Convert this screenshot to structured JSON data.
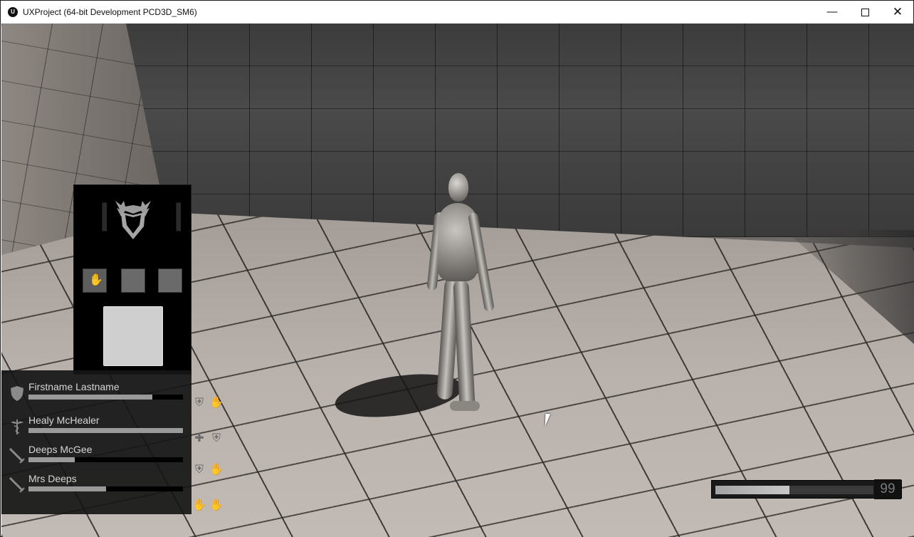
{
  "window": {
    "title": "UXProject (64-bit Development PCD3D_SM6)",
    "app_icon": "unreal-engine-logo",
    "controls": {
      "minimize": "—",
      "close": "✕"
    }
  },
  "ability_panel": {
    "crest_icon": "winged-shield-icon",
    "slots": [
      {
        "icon": "hand-icon",
        "filled": true
      },
      {
        "icon": "empty-slot",
        "filled": false
      },
      {
        "icon": "empty-slot",
        "filled": false
      }
    ],
    "primary_slot": {
      "filled": false
    }
  },
  "party": {
    "members": [
      {
        "name": "Firstname Lastname",
        "class_icon": "shield-icon",
        "health": 0.8,
        "buffs": [
          "shield-buff-icon",
          "hand-buff-icon"
        ]
      },
      {
        "name": "Healy McHealer",
        "class_icon": "caduceus-icon",
        "health": 1.0,
        "buffs": [
          "cross-buff-icon",
          "shield-buff-icon"
        ]
      },
      {
        "name": "Deeps McGee",
        "class_icon": "sword-icon",
        "health": 0.3,
        "buffs": [
          "shield-buff-icon",
          "hand-buff-icon"
        ]
      },
      {
        "name": "Mrs Deeps",
        "class_icon": "sword-icon",
        "health": 0.5,
        "buffs": [
          "hand-buff-icon",
          "hand-buff-icon"
        ]
      }
    ]
  },
  "resource_meter": {
    "fill": 0.47,
    "count": "99"
  },
  "colors": {
    "panel_bg": "#000000",
    "party_bg": "#161616",
    "bar_fill": "#9a9a9a"
  }
}
